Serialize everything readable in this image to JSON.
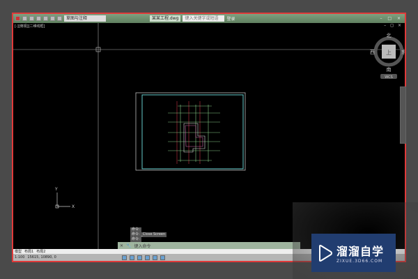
{
  "titlebar": {
    "workspace": "草图与注释",
    "filename": "某某工程.dwg",
    "search_placeholder": "键入关键字或短语",
    "login": "登录",
    "window_controls": "– □ ×"
  },
  "viewport": {
    "label": "[-][俯视][二维线框]",
    "controls": "– ◻ ×"
  },
  "viewcube": {
    "north": "北",
    "south": "南",
    "east": "东",
    "west": "西",
    "top": "上",
    "wcs": "WCS"
  },
  "ucs": {
    "x": "X",
    "y": "Y"
  },
  "command": {
    "history": [
      "命令:",
      "命令: _Close Screen",
      "命令:"
    ],
    "input_placeholder": "键入命令"
  },
  "tabs": [
    "模型",
    "布局1",
    "布局2"
  ],
  "status": {
    "scale": "1:100",
    "coords": "15615, 10890, 0"
  },
  "watermark": {
    "name": "溜溜自学",
    "url": "ZIXUE.3D66.COM"
  }
}
